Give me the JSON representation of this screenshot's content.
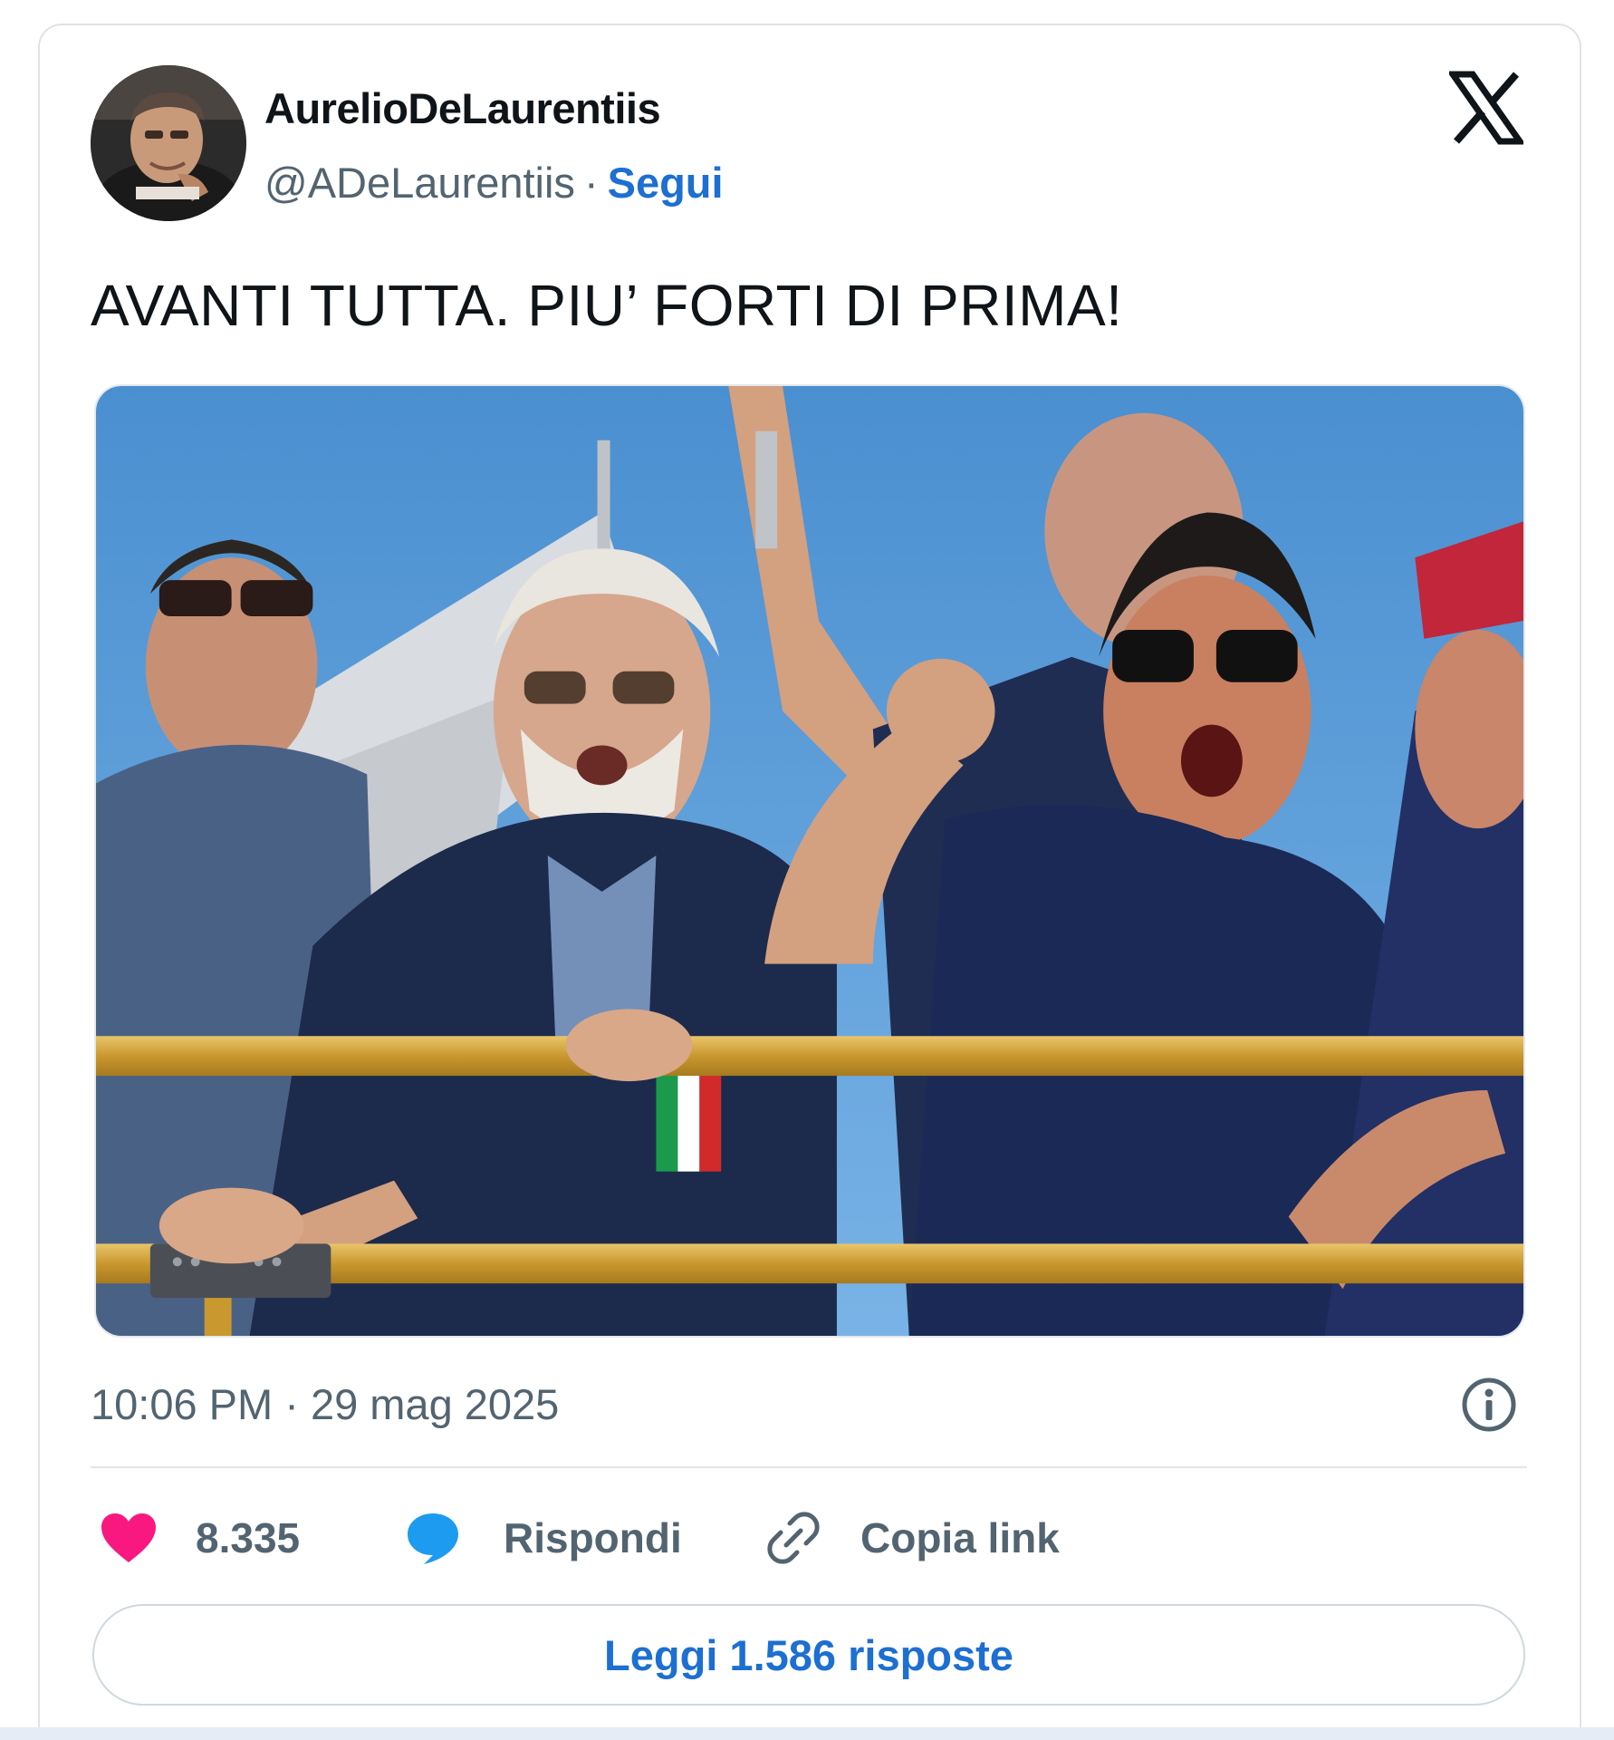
{
  "author": {
    "display_name": "AurelioDeLaurentiis",
    "handle": "@ADeLaurentiis",
    "separator": "·",
    "follow_label": "Segui"
  },
  "tweet": {
    "text": "AVANTI TUTTA. PIU’ FORTI DI PRIMA!",
    "timestamp": "10:06 PM · 29 mag 2025"
  },
  "actions": {
    "like_count": "8.335",
    "reply_label": "Rispondi",
    "copy_link_label": "Copia link"
  },
  "read_replies_label": "Leggi 1.586 risposte",
  "icons": {
    "platform_logo": "x-logo-icon",
    "info": "info-icon",
    "like": "heart-icon",
    "reply": "speech-bubble-icon",
    "copy_link": "link-icon"
  },
  "colors": {
    "text_primary": "#0f1419",
    "text_secondary": "#536471",
    "link_blue": "#1d6fd1",
    "heart_pink": "#f91880",
    "reply_blue": "#1d9bf0",
    "border": "#cfd9de"
  }
}
